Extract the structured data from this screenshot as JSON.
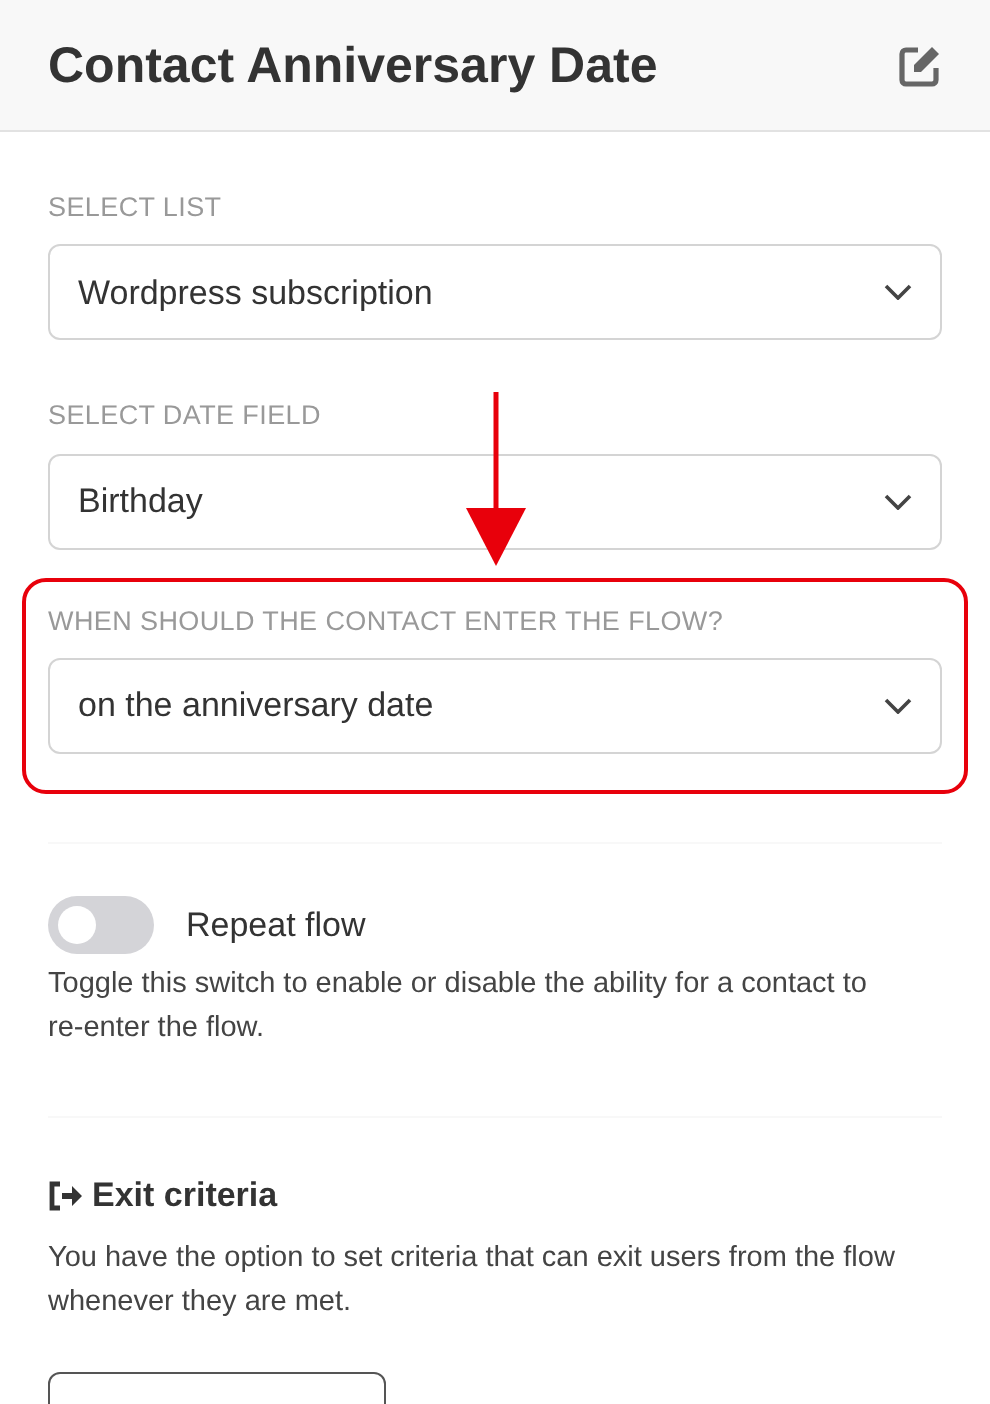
{
  "header": {
    "title": "Contact Anniversary Date"
  },
  "fields": [
    {
      "label": "SELECT LIST",
      "value": "Wordpress subscription",
      "highlighted": false
    },
    {
      "label": "SELECT DATE FIELD",
      "value": "Birthday",
      "highlighted": false
    },
    {
      "label": "WHEN SHOULD THE CONTACT ENTER THE FLOW?",
      "value": "on the anniversary date",
      "highlighted": true
    }
  ],
  "repeat": {
    "label": "Repeat flow",
    "on": false,
    "description": "Toggle this switch to enable or disable the ability for a contact to re-enter the flow."
  },
  "exit": {
    "title": "Exit criteria",
    "description": "You have the option to set criteria that can exit users from the flow whenever they are met."
  }
}
